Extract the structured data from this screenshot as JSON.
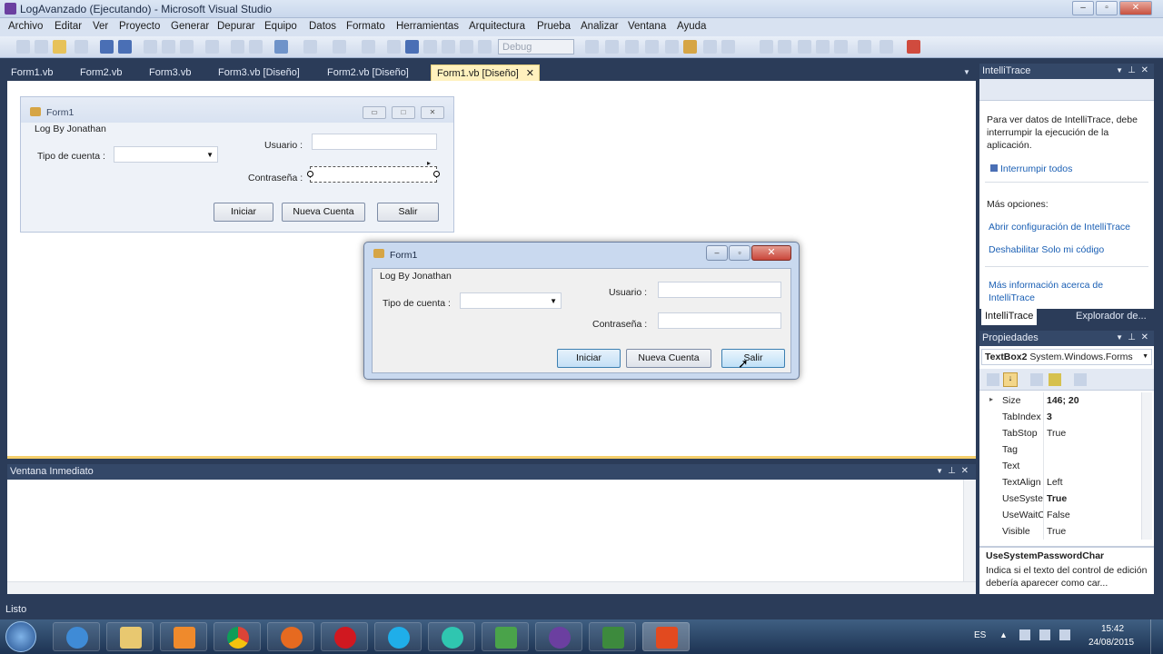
{
  "window": {
    "title": "LogAvanzado (Ejecutando) - Microsoft Visual Studio"
  },
  "menu": [
    "Archivo",
    "Editar",
    "Ver",
    "Proyecto",
    "Generar",
    "Depurar",
    "Equipo",
    "Datos",
    "Formato",
    "Herramientas",
    "Arquitectura",
    "Prueba",
    "Analizar",
    "Ventana",
    "Ayuda"
  ],
  "toolbar": {
    "config": "Debug"
  },
  "doc_tabs": [
    "Form1.vb",
    "Form2.vb",
    "Form3.vb",
    "Form3.vb [Diseño]",
    "Form2.vb [Diseño]",
    "Form1.vb [Diseño]"
  ],
  "design_form": {
    "title": "Form1",
    "heading": "Log By Jonathan",
    "account_type_label": "Tipo de cuenta :",
    "user_label": "Usuario :",
    "password_label": "Contraseña :",
    "btn_login": "Iniciar",
    "btn_new": "Nueva Cuenta",
    "btn_exit": "Salir"
  },
  "runtime_form": {
    "title": "Form1",
    "heading": "Log By Jonathan",
    "account_type_label": "Tipo de cuenta :",
    "user_label": "Usuario :",
    "password_label": "Contraseña :",
    "btn_login": "Iniciar",
    "btn_new": "Nueva Cuenta",
    "btn_exit": "Salir"
  },
  "immediate": {
    "title": "Ventana Inmediato"
  },
  "intellitrace": {
    "title": "IntelliTrace",
    "message": "Para ver datos de IntelliTrace, debe interrumpir la ejecución de la aplicación.",
    "break_all": "Interrumpir todos",
    "more_options": "Más opciones:",
    "open_config": "Abrir configuración de IntelliTrace",
    "disable_just_my_code": "Deshabilitar Solo mi código",
    "more_info": "Más información acerca de IntelliTrace",
    "tab_intellitrace": "IntelliTrace",
    "tab_explorer": "Explorador de..."
  },
  "properties": {
    "title": "Propiedades",
    "object": "TextBox2",
    "object_type": "System.Windows.Forms",
    "rows": [
      {
        "name": "Size",
        "value": "146; 20",
        "bold": true
      },
      {
        "name": "TabIndex",
        "value": "3",
        "bold": true
      },
      {
        "name": "TabStop",
        "value": "True",
        "bold": false
      },
      {
        "name": "Tag",
        "value": "",
        "bold": false
      },
      {
        "name": "Text",
        "value": "",
        "bold": false
      },
      {
        "name": "TextAlign",
        "value": "Left",
        "bold": false
      },
      {
        "name": "UseSystemPasswordChar",
        "value": "True",
        "bold": true
      },
      {
        "name": "UseWaitCursor",
        "value": "False",
        "bold": false
      },
      {
        "name": "Visible",
        "value": "True",
        "bold": false
      }
    ],
    "desc_title": "UseSystemPasswordChar",
    "desc_text": "Indica si el texto del control de edición debería aparecer como car..."
  },
  "status": {
    "text": "Listo"
  },
  "taskbar": {
    "lang": "ES",
    "time": "15:42",
    "date": "24/08/2015",
    "apps": [
      "ie",
      "explorer",
      "media",
      "chrome",
      "firefox",
      "opera",
      "skype",
      "clock",
      "camtasia",
      "vs",
      "camtasia2",
      "office"
    ]
  }
}
